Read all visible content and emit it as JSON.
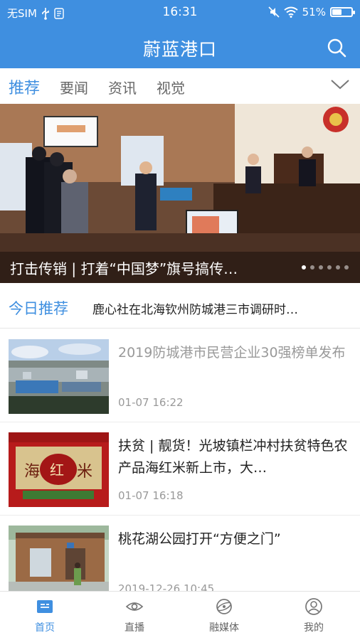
{
  "status_bar": {
    "carrier": "无SIM",
    "time": "16:31",
    "battery": "51%",
    "battery_level": 0.51
  },
  "header": {
    "title": "蔚蓝港口",
    "search_icon": "search-icon"
  },
  "tabs": [
    {
      "label": "推荐",
      "active": true
    },
    {
      "label": "要闻",
      "active": false
    },
    {
      "label": "资讯",
      "active": false
    },
    {
      "label": "视觉",
      "active": false
    }
  ],
  "banner": {
    "caption": "打击传销 | 打着“中国梦”旗号搞传…",
    "slide_count": 6,
    "active_slide": 1
  },
  "today": {
    "label": "今日推荐",
    "headline": "鹿心社在北海钦州防城港三市调研时…"
  },
  "news": [
    {
      "title": "2019防城港市民营企业30强榜单发布",
      "time": "01-07 16:22",
      "read": true
    },
    {
      "title": "扶贫 | 靓货！光坡镇栏冲村扶贫特色农产品海红米新上市，大…",
      "time": "01-07 16:18",
      "read": false
    },
    {
      "title": "桃花湖公园打开“方便之门”",
      "time": "2019-12-26 10:45",
      "read": false
    }
  ],
  "bottom_nav": [
    {
      "label": "首页",
      "icon": "home-icon",
      "active": true
    },
    {
      "label": "直播",
      "icon": "eye-icon",
      "active": false
    },
    {
      "label": "融媒体",
      "icon": "globe-icon",
      "active": false
    },
    {
      "label": "我的",
      "icon": "user-icon",
      "active": false
    }
  ],
  "colors": {
    "brand": "#3f8fe0",
    "text": "#222222",
    "muted": "#999999"
  }
}
